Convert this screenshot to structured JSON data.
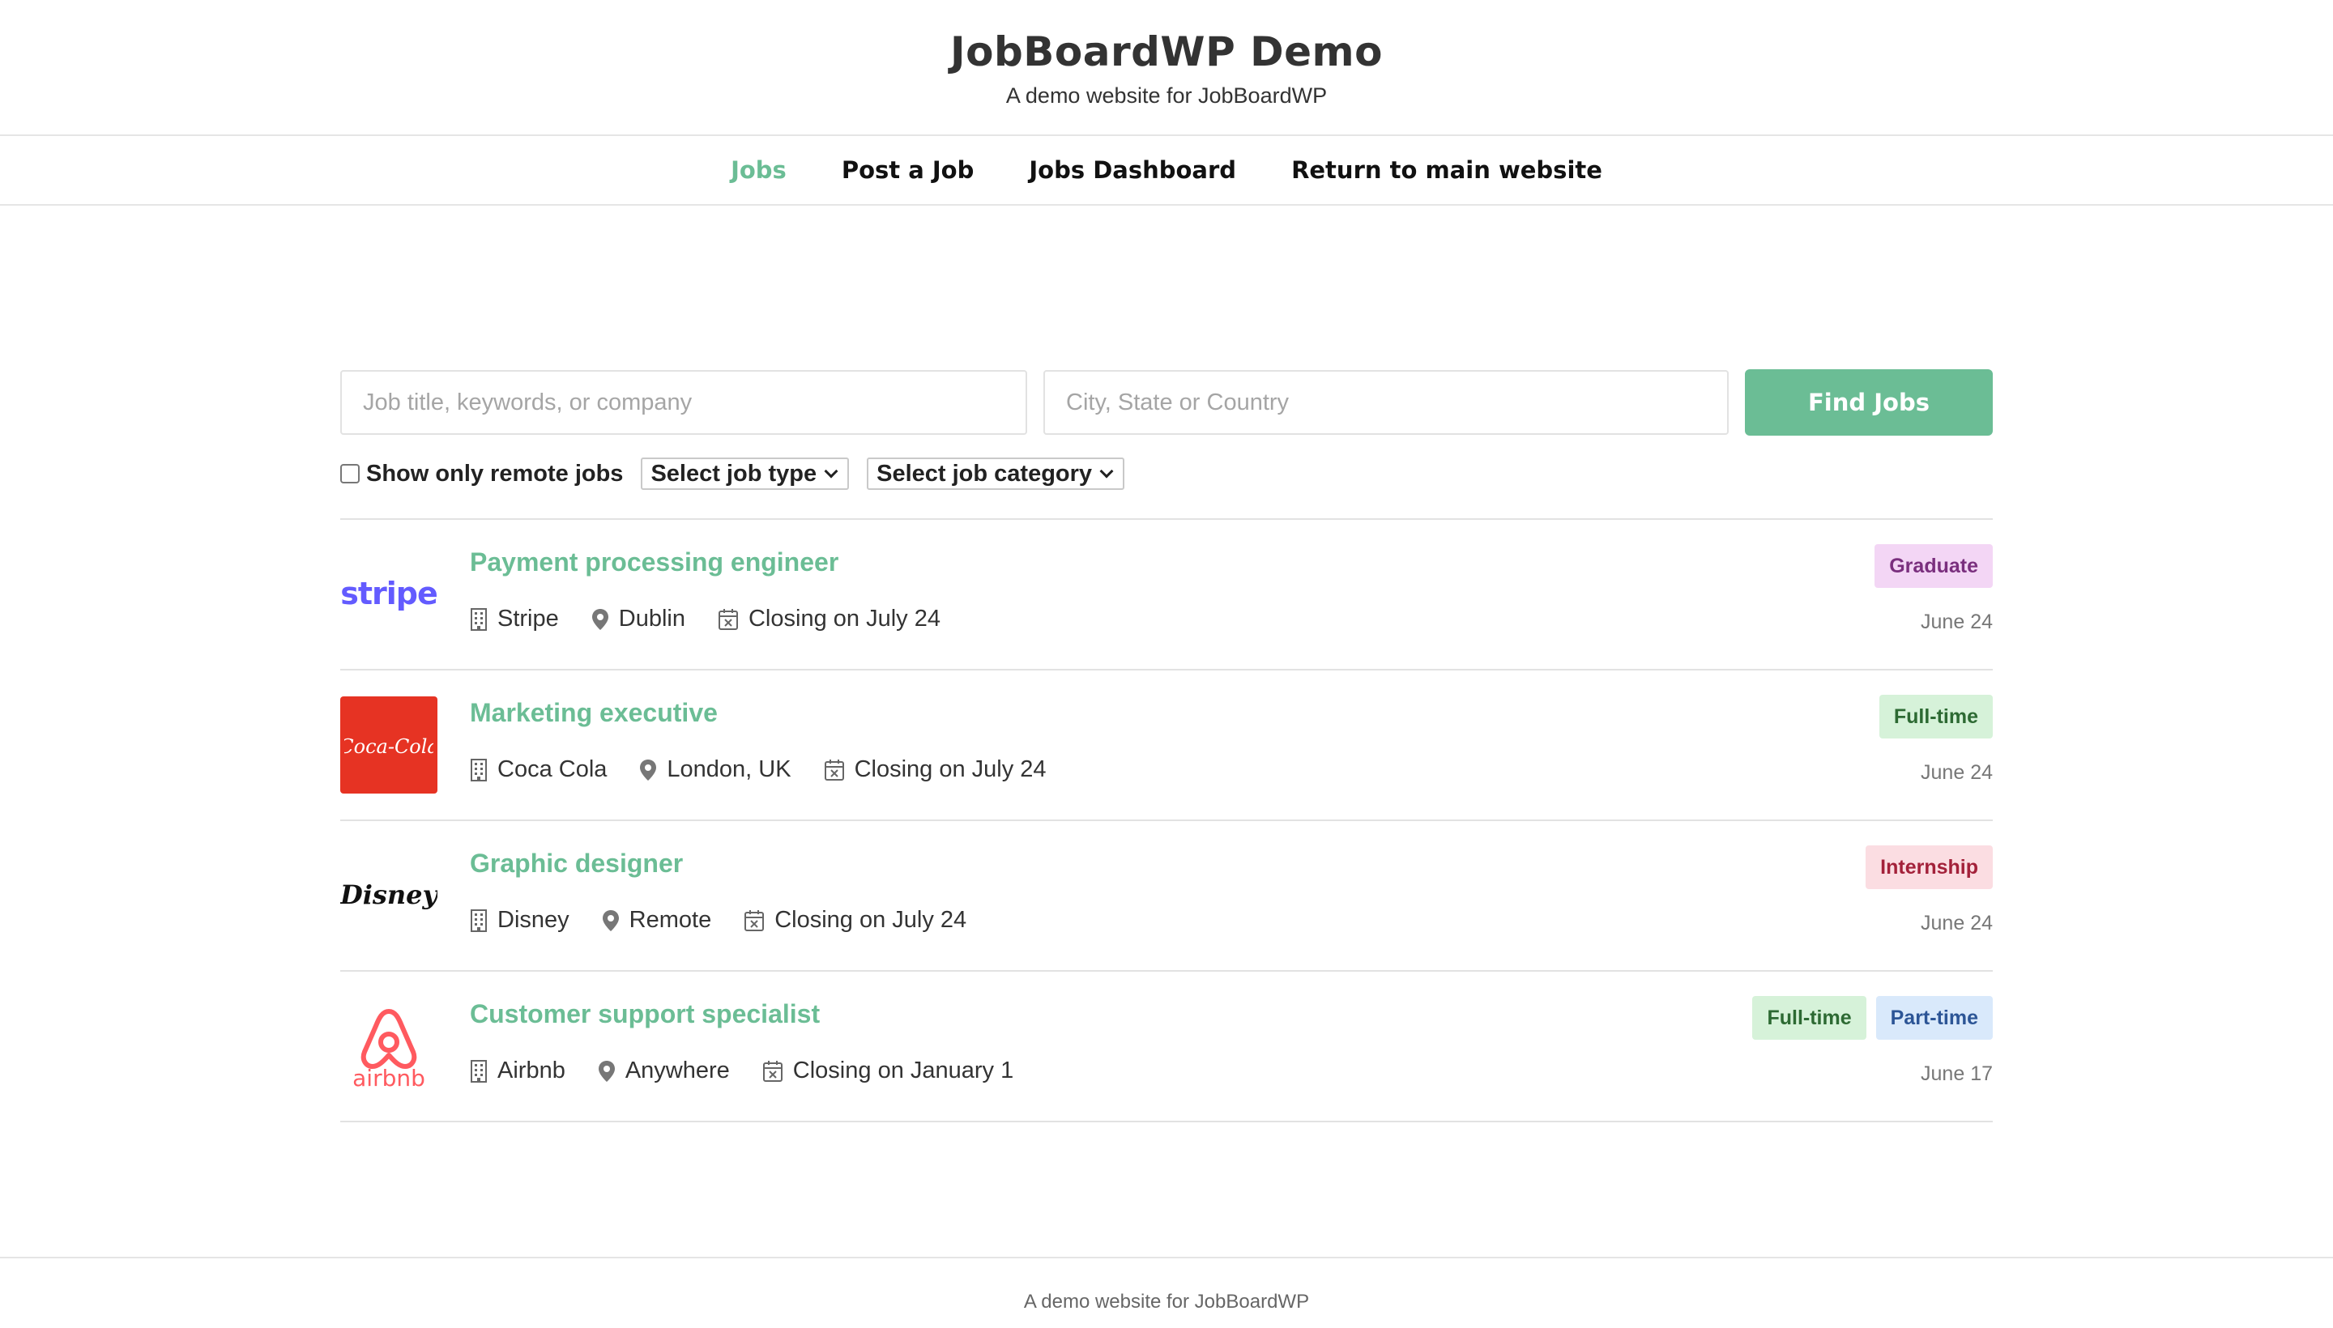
{
  "site": {
    "title": "JobBoardWP Demo",
    "tagline": "A demo website for JobBoardWP"
  },
  "nav": {
    "items": [
      {
        "label": "Jobs",
        "active": true
      },
      {
        "label": "Post a Job"
      },
      {
        "label": "Jobs Dashboard"
      },
      {
        "label": "Return to main website"
      }
    ]
  },
  "search": {
    "keyword_placeholder": "Job title, keywords, or company",
    "keyword_value": "",
    "location_placeholder": "City, State or Country",
    "location_value": "",
    "button_label": "Find Jobs"
  },
  "filters": {
    "remote_label": "Show only remote jobs",
    "remote_checked": false,
    "job_type": "Select job type",
    "job_category": "Select job category"
  },
  "jobs": [
    {
      "title": "Payment processing engineer",
      "company": "Stripe",
      "location": "Dublin",
      "closing": "Closing on July 24",
      "tags": [
        {
          "label": "Graduate",
          "bg": "#f3d6f5",
          "fg": "#7a2f7e"
        }
      ],
      "date": "June 24",
      "logo": "stripe-logo",
      "logo_text": "stripe"
    },
    {
      "title": "Marketing executive",
      "company": "Coca Cola",
      "location": "London, UK",
      "closing": "Closing on July 24",
      "tags": [
        {
          "label": "Full-time",
          "bg": "#d6f2d9",
          "fg": "#2d6a33"
        }
      ],
      "date": "June 24",
      "logo": "coca-cola-logo",
      "logo_text": "Coca-Cola"
    },
    {
      "title": "Graphic designer",
      "company": "Disney",
      "location": "Remote",
      "closing": "Closing on July 24",
      "tags": [
        {
          "label": "Internship",
          "bg": "#fbdde2",
          "fg": "#a3213a"
        }
      ],
      "date": "June 24",
      "logo": "disney-logo",
      "logo_text": "Disney"
    },
    {
      "title": "Customer support specialist",
      "company": "Airbnb",
      "location": "Anywhere",
      "closing": "Closing on January 1",
      "tags": [
        {
          "label": "Full-time",
          "bg": "#d6f2d9",
          "fg": "#2d6a33"
        },
        {
          "label": "Part-time",
          "bg": "#d9e9fb",
          "fg": "#2c5596"
        }
      ],
      "date": "June 17",
      "logo": "airbnb-logo",
      "logo_text": "airbnb"
    }
  ],
  "footer": {
    "text": "A demo website for JobBoardWP"
  },
  "colors": {
    "accent": "#6bbd95",
    "stripe": "#635bff",
    "coca_cola": "#e63323",
    "airbnb": "#ff5a5f"
  }
}
